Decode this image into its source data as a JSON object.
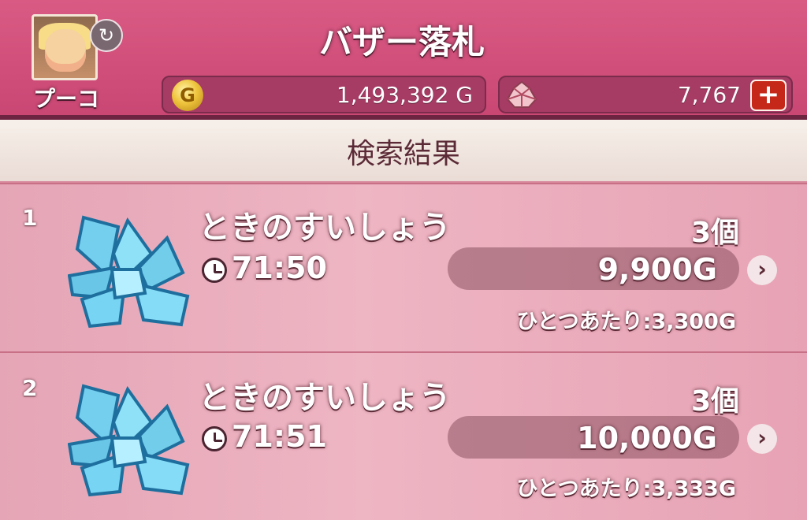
{
  "header": {
    "title": "バザー落札",
    "player_name": "プーコ",
    "gold": "1,493,392 G",
    "gems": "7,767",
    "icons": {
      "avatar": "character-avatar",
      "refresh": "refresh-icon",
      "coin": "gold-coin-icon",
      "gem": "gem-icon",
      "add": "plus-icon"
    }
  },
  "results": {
    "title": "検索結果",
    "items": [
      {
        "rank": "1",
        "name": "ときのすいしょう",
        "quantity": "3個",
        "time": "71:50",
        "price": "9,900G",
        "unit_price": "ひとつあたり:3,300G",
        "icon": "crystal-icon"
      },
      {
        "rank": "2",
        "name": "ときのすいしょう",
        "quantity": "3個",
        "time": "71:51",
        "price": "10,000G",
        "unit_price": "ひとつあたり:3,333G",
        "icon": "crystal-icon"
      }
    ]
  },
  "colors": {
    "header_pink": "#d95b84",
    "list_pink": "#eeb5c3",
    "text_shadow": "#5b2a36",
    "accent_red": "#c52819"
  }
}
